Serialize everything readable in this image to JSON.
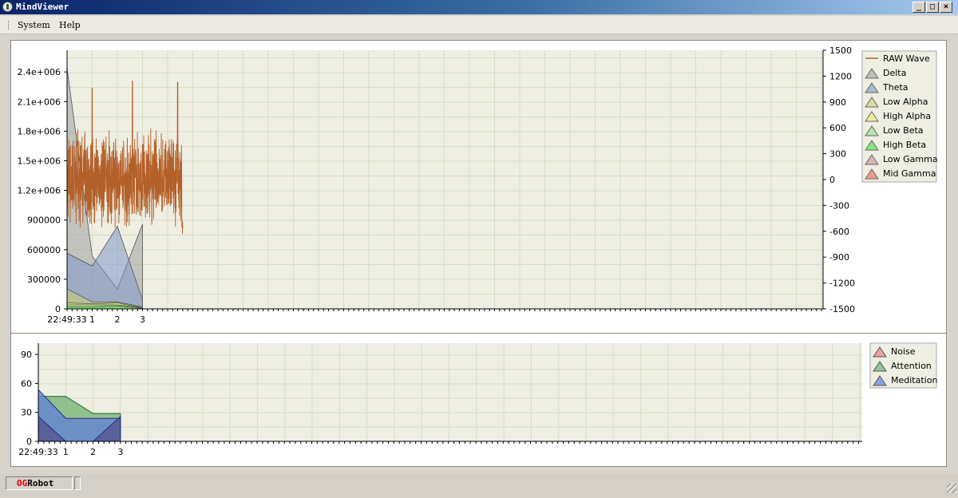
{
  "window": {
    "title": "MindViewer"
  },
  "menu": {
    "system": "System",
    "help": "Help"
  },
  "status": {
    "brand_prefix": "OG",
    "brand_suffix": "Robot"
  },
  "colors": {
    "plot_bg": "#eeeee2",
    "grid": "#d8dcc4",
    "raw": "#b4602a",
    "brand_red": "#e00000"
  },
  "chart_data": [
    {
      "type": "area",
      "x_labels": [
        "22:49:33",
        "1",
        "2",
        "3"
      ],
      "y_left": {
        "ticks": [
          "2.4e+006",
          "2.1e+006",
          "1.8e+006",
          "1.5e+006",
          "1.2e+006",
          "900000",
          "600000",
          "300000",
          "0"
        ],
        "range": [
          0,
          2600000
        ]
      },
      "y_right": {
        "ticks": [
          "1500",
          "1200",
          "900",
          "600",
          "300",
          "0",
          "-300",
          "-600",
          "-900",
          "-1200",
          "-1500"
        ],
        "range": [
          -1500,
          1500
        ]
      },
      "legend": [
        {
          "name": "RAW Wave",
          "color": "#b4602a",
          "kind": "line"
        },
        {
          "name": "Delta",
          "color": "#a0a0a0",
          "kind": "area"
        },
        {
          "name": "Theta",
          "color": "#8098c8",
          "kind": "area"
        },
        {
          "name": "Low Alpha",
          "color": "#d0d070",
          "kind": "area"
        },
        {
          "name": "High Alpha",
          "color": "#f0f070",
          "kind": "area"
        },
        {
          "name": "Low Beta",
          "color": "#90e090",
          "kind": "area"
        },
        {
          "name": "High Beta",
          "color": "#40e040",
          "kind": "area"
        },
        {
          "name": "Low Gamma",
          "color": "#d09090",
          "kind": "area"
        },
        {
          "name": "Mid Gamma",
          "color": "#f06060",
          "kind": "area"
        }
      ],
      "series": [
        {
          "name": "Delta",
          "x": [
            0,
            1,
            2,
            3
          ],
          "values": [
            2420000,
            530000,
            200000,
            850000
          ]
        },
        {
          "name": "Theta",
          "x": [
            0,
            1,
            2,
            3
          ],
          "values": [
            560000,
            430000,
            830000,
            90000
          ]
        },
        {
          "name": "Low Alpha",
          "x": [
            0,
            1,
            2,
            3
          ],
          "values": [
            200000,
            70000,
            70000,
            20000
          ]
        },
        {
          "name": "High Alpha",
          "x": [
            0,
            1,
            2,
            3
          ],
          "values": [
            60000,
            50000,
            60000,
            10000
          ]
        },
        {
          "name": "Low Beta",
          "x": [
            0,
            1,
            2,
            3
          ],
          "values": [
            40000,
            40000,
            40000,
            10000
          ]
        },
        {
          "name": "High Beta",
          "x": [
            0,
            1,
            2,
            3
          ],
          "values": [
            20000,
            20000,
            30000,
            5000
          ]
        }
      ],
      "raw_wave": {
        "x_range": [
          0,
          4.6
        ],
        "baseline": 0,
        "amplitude": 600,
        "spikes": [
          1.0,
          2.6,
          4.4
        ],
        "spike_max": 1150,
        "end_min": -700
      }
    },
    {
      "type": "area",
      "x_labels": [
        "22:49:33",
        "1",
        "2",
        "3"
      ],
      "y": {
        "ticks": [
          "90",
          "60",
          "30",
          "0"
        ],
        "range": [
          0,
          100
        ]
      },
      "legend": [
        {
          "name": "Noise",
          "color": "#f08080"
        },
        {
          "name": "Attention",
          "color": "#70b070"
        },
        {
          "name": "Meditation",
          "color": "#6080d8"
        }
      ],
      "series": [
        {
          "name": "Attention",
          "x": [
            0,
            1,
            2,
            3
          ],
          "values": [
            47,
            47,
            29,
            29
          ]
        },
        {
          "name": "Meditation",
          "x": [
            0,
            1,
            2,
            3
          ],
          "values": [
            54,
            24,
            24,
            24
          ]
        },
        {
          "name": "Noise",
          "x": [
            0,
            1,
            2,
            3
          ],
          "values": [
            26,
            0,
            0,
            26
          ]
        }
      ]
    }
  ]
}
